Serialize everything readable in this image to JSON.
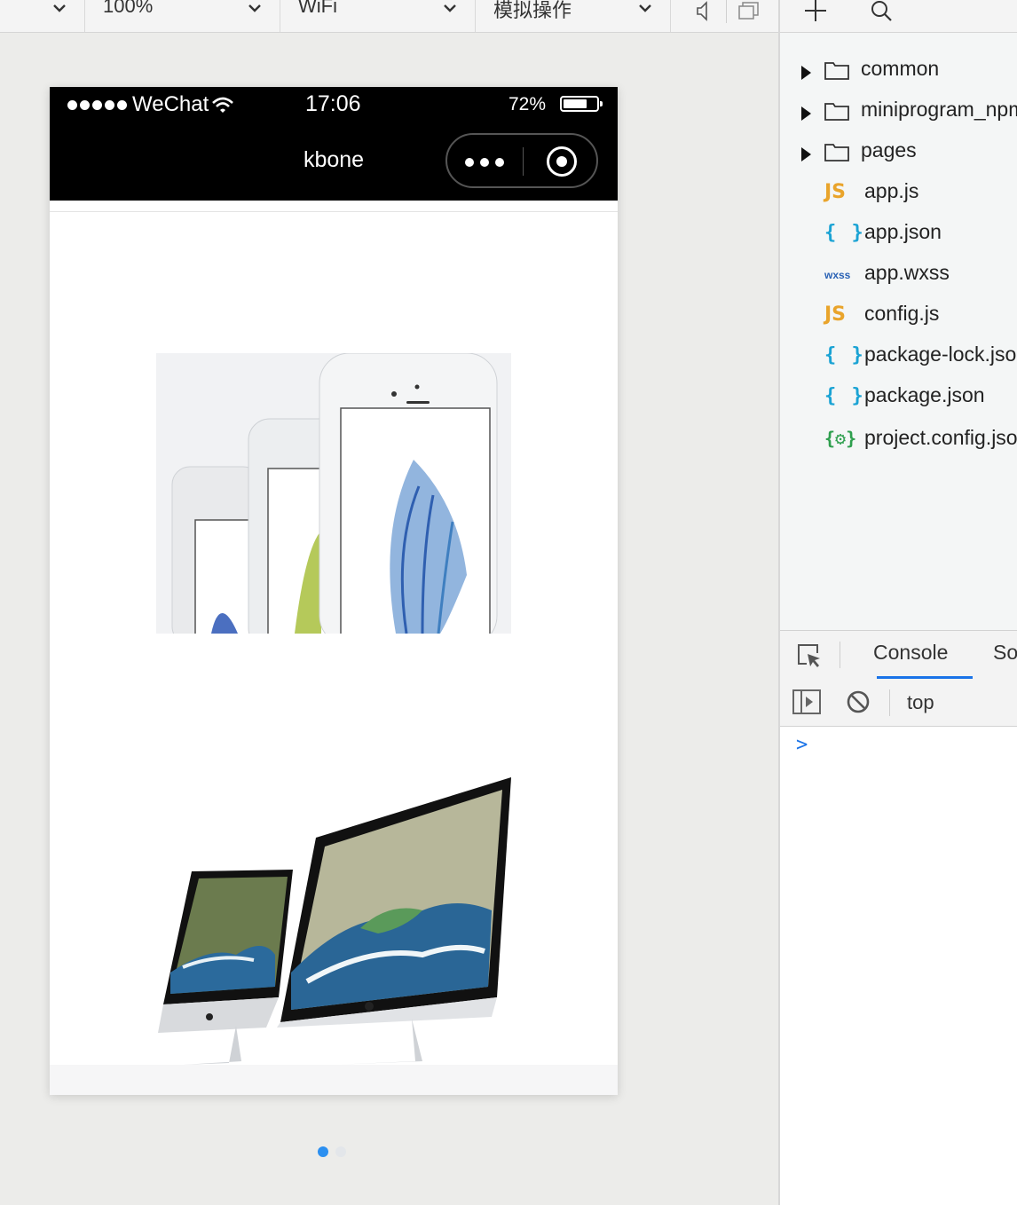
{
  "toolbar": {
    "zoom_label": "100%",
    "network_label": "WiFi",
    "simulate_label": "模拟操作"
  },
  "phone": {
    "status": {
      "carrier": "WeChat",
      "time": "17:06",
      "battery_percent": "72%",
      "battery_level": 0.72
    },
    "nav_title": "kbone",
    "carousel": {
      "slides": [
        "iphone-product-image",
        "imac-product-image"
      ],
      "active_index": 0,
      "active_color": "#2b8ff0",
      "inactive_color": "#e3e6ea"
    }
  },
  "file_tree": {
    "items": [
      {
        "name": "common",
        "type": "folder"
      },
      {
        "name": "miniprogram_npm",
        "type": "folder"
      },
      {
        "name": "pages",
        "type": "folder"
      },
      {
        "name": "app.js",
        "type": "js"
      },
      {
        "name": "app.json",
        "type": "json"
      },
      {
        "name": "app.wxss",
        "type": "wxss"
      },
      {
        "name": "config.js",
        "type": "js"
      },
      {
        "name": "package-lock.json",
        "type": "json"
      },
      {
        "name": "package.json",
        "type": "json"
      },
      {
        "name": "project.config.json",
        "type": "config"
      }
    ],
    "icon_labels": {
      "js": "JS",
      "json": "{ }",
      "wxss": "wxss",
      "config": "{⚙}"
    }
  },
  "console": {
    "tabs": [
      "Console",
      "Sources"
    ],
    "active_tab": "Console",
    "context": "top",
    "prompt": ">"
  }
}
